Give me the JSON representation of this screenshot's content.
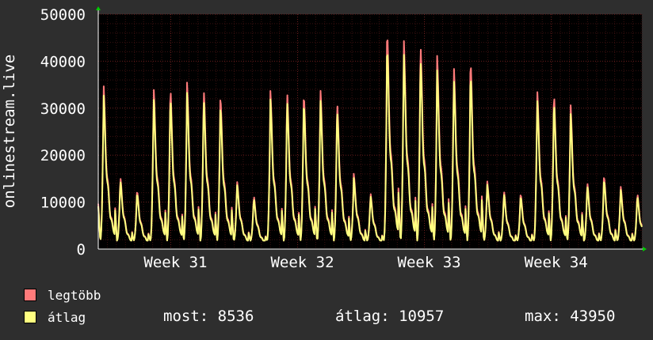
{
  "chart_data": {
    "type": "area",
    "ylabel": "onlinestream.live",
    "ylim": [
      0,
      50000
    ],
    "y_ticks": [
      "0",
      "10000",
      "20000",
      "30000",
      "40000",
      "50000"
    ],
    "y_tick_values": [
      0,
      10000,
      20000,
      30000,
      40000,
      50000
    ],
    "x_ticks": [
      "Week 31",
      "Week 32",
      "Week 33",
      "Week 34"
    ],
    "x_tick_days": [
      4,
      11,
      18,
      25
    ],
    "days": 30,
    "grid": true,
    "legend_placement": "bottom",
    "series": [
      {
        "name": "legtöbb",
        "color": "#ff7a7a",
        "daily_peaks": [
          34500,
          15000,
          12200,
          34200,
          34500,
          35200,
          34000,
          32700,
          14000,
          11000,
          33300,
          33400,
          33200,
          33800,
          31400,
          15500,
          11500,
          47000,
          44500,
          44000,
          40600,
          39000,
          40500,
          14000,
          12000,
          11500,
          33800,
          33300,
          30400,
          13800,
          15400,
          13000,
          11500
        ]
      },
      {
        "name": "átlag",
        "color": "#ffff80",
        "daily_peaks": [
          32500,
          14200,
          11600,
          32000,
          32300,
          33000,
          31800,
          30500,
          13300,
          10400,
          31500,
          31500,
          31300,
          31600,
          29600,
          14600,
          10900,
          43600,
          41500,
          40800,
          37500,
          36200,
          37500,
          13300,
          11400,
          10900,
          31800,
          31400,
          28500,
          13100,
          14500,
          12300,
          10900
        ]
      }
    ]
  },
  "legend": {
    "items": [
      {
        "label": "legtöbb",
        "color": "#ff7a7a"
      },
      {
        "label": "átlag",
        "color": "#ffff80"
      }
    ],
    "stats": {
      "now": "most: 8536",
      "avg": "átlag: 10957",
      "max": "max: 43950"
    }
  },
  "colors": {
    "background": "#2e2e2e",
    "plot_background": "#000000",
    "grid_minor": "#3a1010",
    "grid_major": "#6a1e1e",
    "axis": "#ffffff",
    "arrow": "#00cc00"
  }
}
